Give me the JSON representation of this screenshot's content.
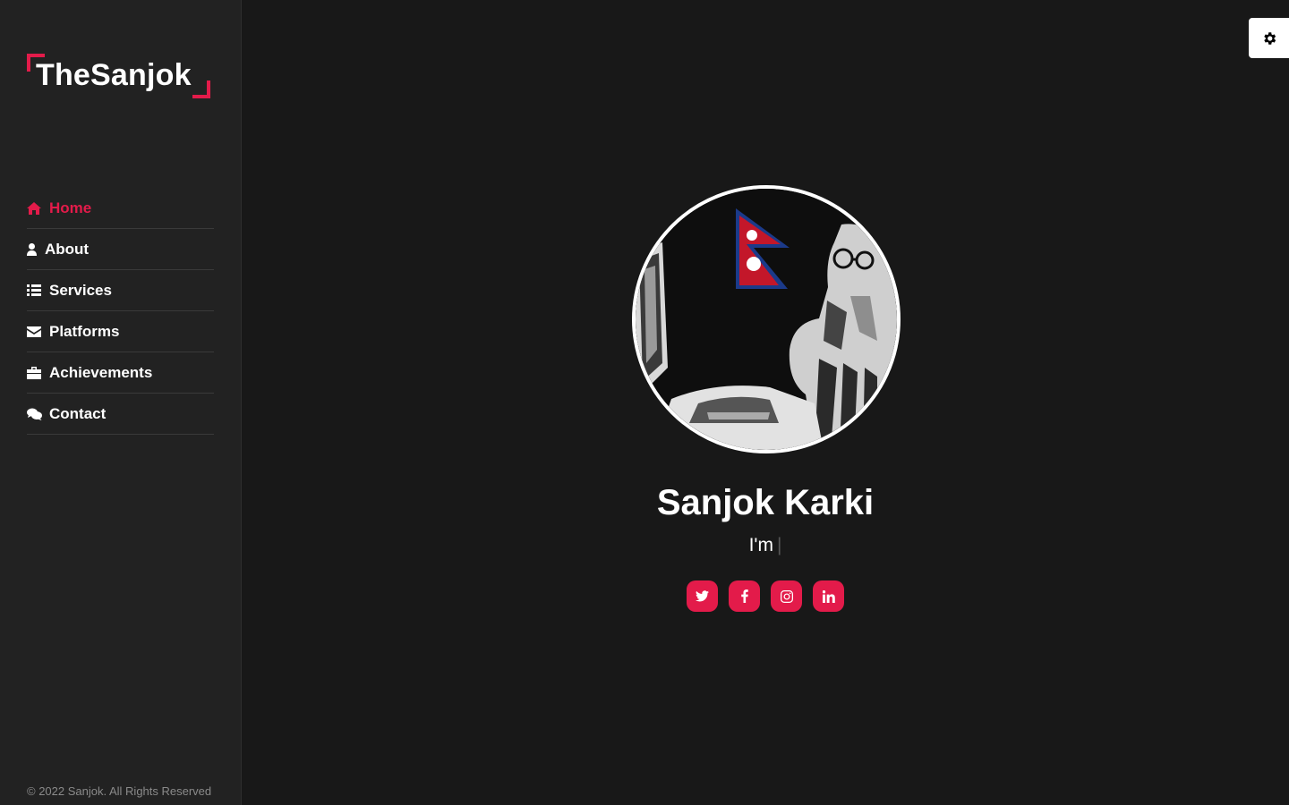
{
  "brand": {
    "logo_text": "TheSanjok",
    "accent_color": "#e31b4a"
  },
  "nav": {
    "items": [
      {
        "label": "Home",
        "icon": "home-icon",
        "active": true
      },
      {
        "label": "About",
        "icon": "user-icon"
      },
      {
        "label": "Services",
        "icon": "list-icon"
      },
      {
        "label": "Platforms",
        "icon": "envelope-icon"
      },
      {
        "label": "Achievements",
        "icon": "briefcase-icon"
      },
      {
        "label": "Contact",
        "icon": "comments-icon"
      }
    ]
  },
  "footer": {
    "copyright": "© 2022 Sanjok. All Rights Reserved"
  },
  "settings": {
    "icon": "gear-icon"
  },
  "profile": {
    "name": "Sanjok Karki",
    "typed_prefix": "I'm",
    "typed_cursor": "|",
    "avatar": "avatar-illustration-nepal-flag"
  },
  "socials": [
    {
      "name": "twitter",
      "icon": "twitter-icon"
    },
    {
      "name": "facebook",
      "icon": "facebook-icon"
    },
    {
      "name": "instagram",
      "icon": "instagram-icon"
    },
    {
      "name": "linkedin",
      "icon": "linkedin-icon"
    }
  ]
}
